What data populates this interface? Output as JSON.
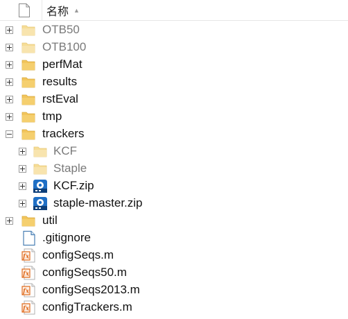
{
  "header": {
    "name_label": "名称",
    "sort_indicator": "▲",
    "icon": "blank-document-icon"
  },
  "tree": [
    {
      "label": "OTB50",
      "kind": "folder",
      "level": 0,
      "expander": "collapsed",
      "dim": true
    },
    {
      "label": "OTB100",
      "kind": "folder",
      "level": 0,
      "expander": "collapsed",
      "dim": true
    },
    {
      "label": "perfMat",
      "kind": "folder",
      "level": 0,
      "expander": "collapsed",
      "dim": false
    },
    {
      "label": "results",
      "kind": "folder",
      "level": 0,
      "expander": "collapsed",
      "dim": false
    },
    {
      "label": "rstEval",
      "kind": "folder",
      "level": 0,
      "expander": "collapsed",
      "dim": false
    },
    {
      "label": "tmp",
      "kind": "folder",
      "level": 0,
      "expander": "collapsed",
      "dim": false
    },
    {
      "label": "trackers",
      "kind": "folder",
      "level": 0,
      "expander": "expanded",
      "dim": false
    },
    {
      "label": "KCF",
      "kind": "folder",
      "level": 1,
      "expander": "collapsed",
      "dim": true
    },
    {
      "label": "Staple",
      "kind": "folder",
      "level": 1,
      "expander": "collapsed",
      "dim": true
    },
    {
      "label": "KCF.zip",
      "kind": "zip",
      "level": 1,
      "expander": "collapsed",
      "dim": false
    },
    {
      "label": "staple-master.zip",
      "kind": "zip",
      "level": 1,
      "expander": "collapsed",
      "dim": false
    },
    {
      "label": "util",
      "kind": "folder",
      "level": 0,
      "expander": "collapsed",
      "dim": false
    },
    {
      "label": ".gitignore",
      "kind": "file",
      "level": 0,
      "expander": "none",
      "dim": false
    },
    {
      "label": "configSeqs.m",
      "kind": "mfile",
      "level": 0,
      "expander": "none",
      "dim": false
    },
    {
      "label": "configSeqs50.m",
      "kind": "mfile",
      "level": 0,
      "expander": "none",
      "dim": false
    },
    {
      "label": "configSeqs2013.m",
      "kind": "mfile",
      "level": 0,
      "expander": "none",
      "dim": false
    },
    {
      "label": "configTrackers.m",
      "kind": "mfile",
      "level": 0,
      "expander": "none",
      "dim": false
    }
  ],
  "colors": {
    "folder": "#f2c55c",
    "folder_dim": "#f6dd97",
    "zip_blue": "#1f6fc5",
    "mfile_orange": "#e06c1f",
    "text": "#111111",
    "text_dim": "#7a7a7a"
  }
}
